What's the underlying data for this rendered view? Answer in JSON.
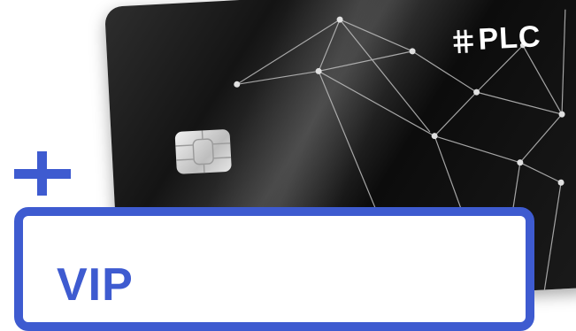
{
  "card": {
    "brand_text": "PLC",
    "brand_mark_icon": "plc-logo-icon",
    "chip_icon": "card-chip-icon",
    "pattern_icon": "network-pattern-icon",
    "colors": {
      "card": "#141414",
      "lines": "#bfbfbf"
    }
  },
  "badge": {
    "plus_icon": "plus-icon",
    "label": "VIP",
    "accent_color": "#3e5bd0"
  }
}
